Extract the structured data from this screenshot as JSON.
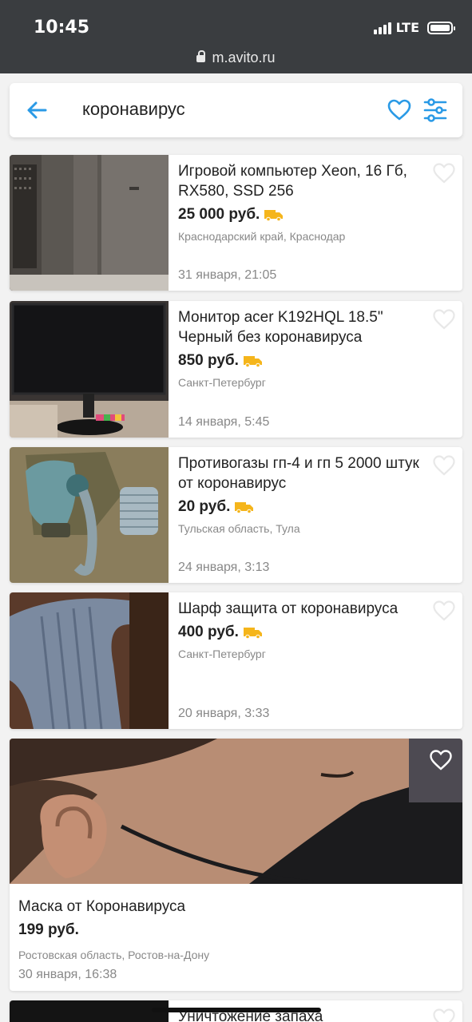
{
  "status": {
    "time": "10:45",
    "network": "LTE",
    "url": "m.avito.ru"
  },
  "search": {
    "query": "коронавирус"
  },
  "colors": {
    "accent": "#2a9ae6",
    "delivery": "#f5b51b"
  },
  "listings": [
    {
      "title": "Игровой компьютер Xeon, 16 Гб, RX580, SSD 256",
      "price": "25 000 руб.",
      "delivery": true,
      "location": "Краснодарский край, Краснодар",
      "date": "31 января, 21:05",
      "icon": "heart-outline-icon"
    },
    {
      "title": "Монитор acer K192HQL 18.5\" Черный без коронавируса",
      "price": "850 руб.",
      "delivery": true,
      "location": "Санкт-Петербург",
      "date": "14 января, 5:45",
      "icon": "heart-outline-icon"
    },
    {
      "title": "Противогазы гп-4 и гп 5 2000 штук от коронавирус",
      "price": "20 руб.",
      "delivery": true,
      "location": "Тульская область, Тула",
      "date": "24 января, 3:13",
      "icon": "heart-outline-icon"
    },
    {
      "title": "Шарф защита от коронавируса",
      "price": "400 руб.",
      "delivery": true,
      "location": "Санкт-Петербург",
      "date": "20 января, 3:33",
      "icon": "heart-outline-icon"
    },
    {
      "title": "Маска от Коронавируса",
      "price": "199 руб.",
      "delivery": false,
      "location": "Ростовская область, Ростов-на-Дону",
      "date": "30 января, 16:38",
      "icon": "heart-outline-icon"
    },
    {
      "title": "Уничтожение запаха",
      "price": "",
      "location": "",
      "date": ""
    }
  ]
}
